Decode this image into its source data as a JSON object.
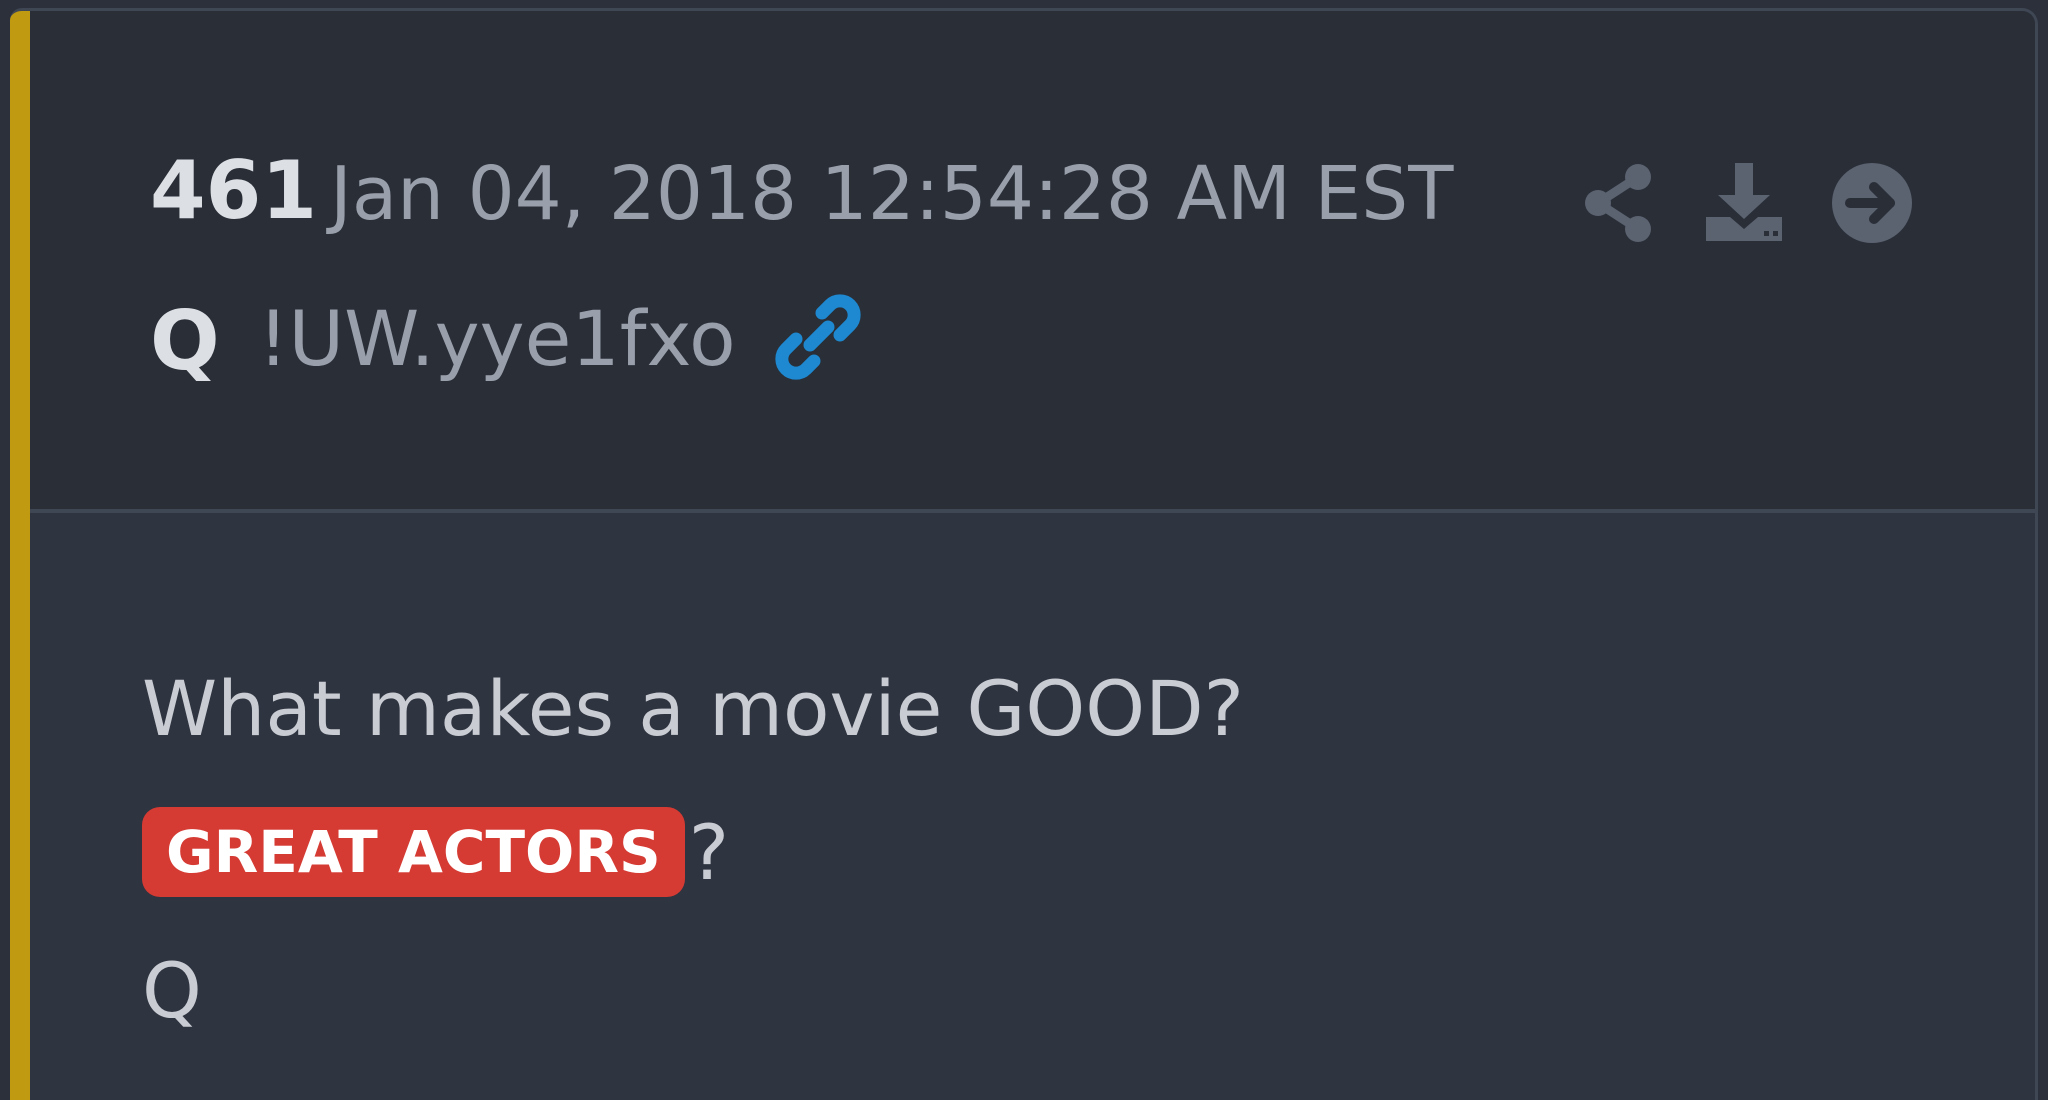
{
  "post": {
    "number": "461",
    "date": "Jan 04, 2018 12:54:28 AM EST",
    "author": "Q",
    "tripcode": "!UW.yye1fxo"
  },
  "actions": {
    "share": "share-icon",
    "download": "download-icon",
    "go": "arrow-circle-right-icon",
    "link": "link-icon"
  },
  "content": {
    "line1": "What makes a movie GOOD?",
    "highlight": "GREAT ACTORS",
    "after_highlight": "?",
    "signature": "Q"
  },
  "colors": {
    "accent": "#c09a10",
    "badge": "#d53a33",
    "link": "#1e88d0",
    "icon": "#5b6270"
  }
}
